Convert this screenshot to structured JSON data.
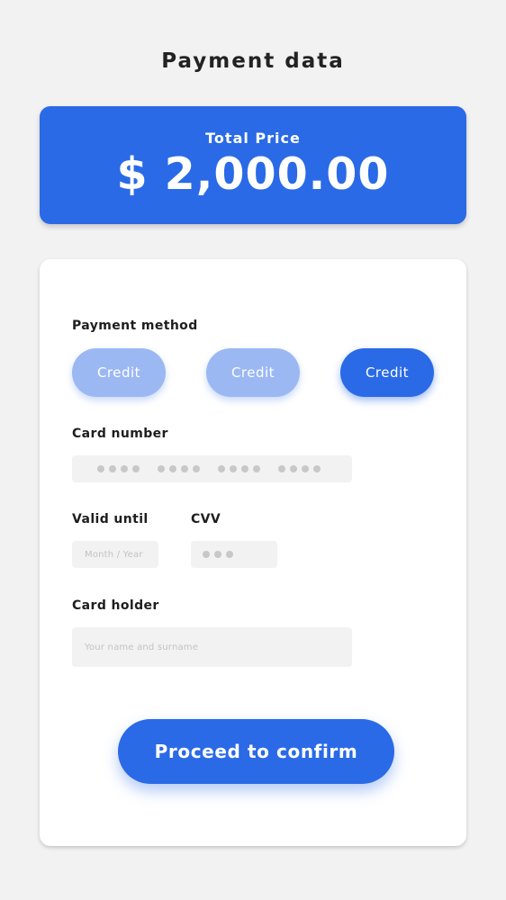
{
  "header": {
    "title": "Payment data"
  },
  "total": {
    "label": "Total  Price",
    "value": "$ 2,000.00"
  },
  "form": {
    "payment_method": {
      "label": "Payment  method",
      "options": [
        {
          "label": "Credit",
          "selected": false
        },
        {
          "label": "Credit",
          "selected": false
        },
        {
          "label": "Credit",
          "selected": true
        }
      ]
    },
    "card_number": {
      "label": "Card number",
      "masked_groups": 4,
      "digits_per_group": 4
    },
    "valid_until": {
      "label": "Valid until",
      "placeholder": "Month / Year"
    },
    "cvv": {
      "label": "CVV",
      "masked_digits": 3
    },
    "card_holder": {
      "label": "Card holder",
      "placeholder": "Your name and surname"
    },
    "confirm_button": {
      "label": "Proceed to confirm"
    }
  },
  "colors": {
    "accent": "#2a6ae6",
    "accent_light": "#9bb8f3",
    "background": "#f2f2f2",
    "field_bg": "#f2f2f2"
  }
}
